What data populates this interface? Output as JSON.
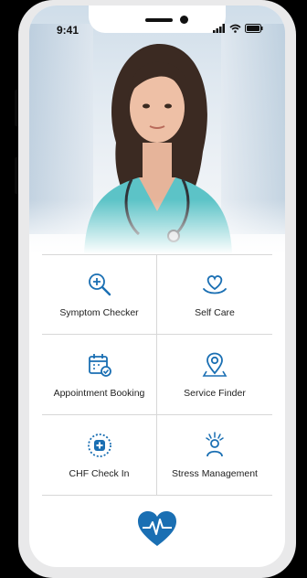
{
  "status_bar": {
    "time": "9:41"
  },
  "menu": [
    {
      "label": "Symptom Checker",
      "icon": "magnifier-plus-icon"
    },
    {
      "label": "Self Care",
      "icon": "heart-hands-icon"
    },
    {
      "label": "Appointment Booking",
      "icon": "calendar-check-icon"
    },
    {
      "label": "Service Finder",
      "icon": "map-pin-icon"
    },
    {
      "label": "CHF Check In",
      "icon": "medical-plus-icon"
    },
    {
      "label": "Stress Management",
      "icon": "stressed-person-icon"
    }
  ],
  "bottom_button": {
    "icon": "heartbeat-heart-icon"
  },
  "colors": {
    "accent": "#1a6fb3",
    "divider": "#d7d7d7"
  }
}
